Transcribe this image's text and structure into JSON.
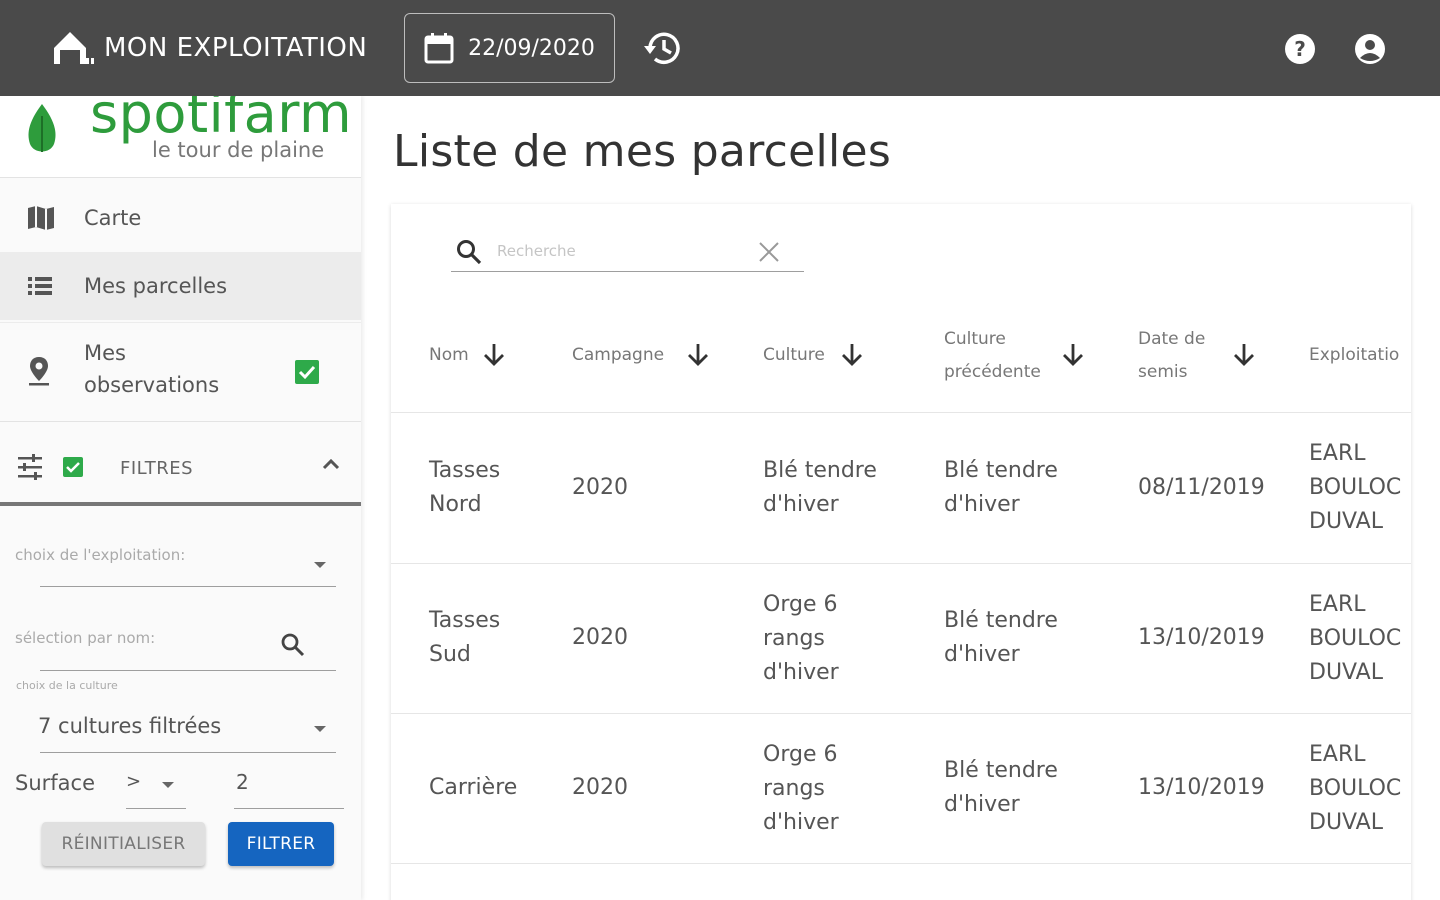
{
  "topbar": {
    "farm_label": "MON EXPLOITATION",
    "date": "22/09/2020"
  },
  "sidebar": {
    "brand": "spotifarm",
    "tagline": "le tour de plaine",
    "nav": {
      "carte": "Carte",
      "parcelles": "Mes parcelles",
      "observations_line1": "Mes",
      "observations_line2": "observations"
    },
    "filters": {
      "title": "FILTRES",
      "exploitation_label": "choix de l'exploitation:",
      "nom_label": "sélection par nom:",
      "culture_label": "choix de la culture",
      "culture_value": "7 cultures filtrées",
      "surface_label": "Surface",
      "surface_operator": ">",
      "surface_value": "2",
      "reset_label": "RÉINITIALISER",
      "filter_label": "FILTRER"
    }
  },
  "main": {
    "title": "Liste de mes parcelles",
    "search_placeholder": "Recherche",
    "columns": {
      "nom": "Nom",
      "campagne": "Campagne",
      "culture": "Culture",
      "culture_prec_1": "Culture",
      "culture_prec_2": "précédente",
      "date_semis_1": "Date de",
      "date_semis_2": "semis",
      "exploitation": "Exploitatio"
    },
    "rows": [
      {
        "nom": [
          "Tasses",
          "Nord"
        ],
        "campagne": "2020",
        "culture": [
          "Blé tendre",
          "d'hiver"
        ],
        "culture_prec": [
          "Blé tendre",
          "d'hiver"
        ],
        "date_semis": "08/11/2019",
        "exploitation": [
          "EARL",
          "BOULOC",
          "DUVAL"
        ]
      },
      {
        "nom": [
          "Tasses",
          "Sud"
        ],
        "campagne": "2020",
        "culture": [
          "Orge 6",
          "rangs",
          "d'hiver"
        ],
        "culture_prec": [
          "Blé tendre",
          "d'hiver"
        ],
        "date_semis": "13/10/2019",
        "exploitation": [
          "EARL",
          "BOULOC",
          "DUVAL"
        ]
      },
      {
        "nom": [
          "Carrière"
        ],
        "campagne": "2020",
        "culture": [
          "Orge 6",
          "rangs",
          "d'hiver"
        ],
        "culture_prec": [
          "Blé tendre",
          "d'hiver"
        ],
        "date_semis": "13/10/2019",
        "exploitation": [
          "EARL",
          "BOULOC",
          "DUVAL"
        ]
      }
    ]
  },
  "colors": {
    "topbar": "#4a4a4a",
    "brand_green": "#2e9c3c",
    "check_green": "#2eaa4a",
    "primary_blue": "#1565c0"
  },
  "icons": [
    "farm-icon",
    "calendar-icon",
    "history-icon",
    "help-icon",
    "account-icon",
    "leaf-logo-icon",
    "map-icon",
    "list-icon",
    "location-pin-icon",
    "checkbox-checked-icon",
    "tune-icon",
    "chevron-up-icon",
    "caret-down-icon",
    "search-icon",
    "close-icon",
    "arrow-down-icon"
  ]
}
